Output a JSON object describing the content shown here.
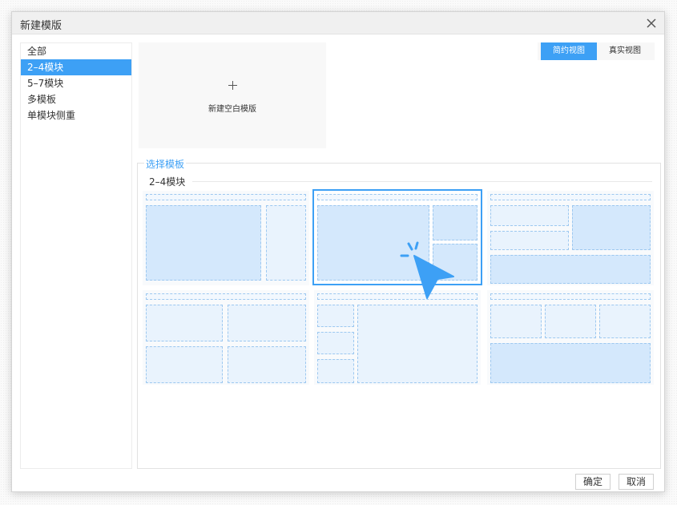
{
  "dialog": {
    "title": "新建模版",
    "close_icon": "close-icon"
  },
  "sidebar": {
    "items": [
      {
        "label": "全部",
        "active": false
      },
      {
        "label": "2–4模块",
        "active": true
      },
      {
        "label": "5–7模块",
        "active": false
      },
      {
        "label": "多模板",
        "active": false
      },
      {
        "label": "单模块侧重",
        "active": false
      }
    ]
  },
  "blank_template": {
    "icon": "plus-icon",
    "label": "新建空白模版"
  },
  "view_toggle": {
    "simple_label": "简约视图",
    "real_label": "真实视图",
    "active": "simple"
  },
  "select": {
    "legend": "选择模板",
    "group_title": "2–4模块",
    "selected_index": 1,
    "template_count": 6
  },
  "footer": {
    "ok_label": "确定",
    "cancel_label": "取消"
  },
  "colors": {
    "accent": "#3da0f5",
    "block_fill": "#e9f3fd",
    "block_fill_dark": "#d4e8fc",
    "block_border": "#9dc8f0"
  }
}
